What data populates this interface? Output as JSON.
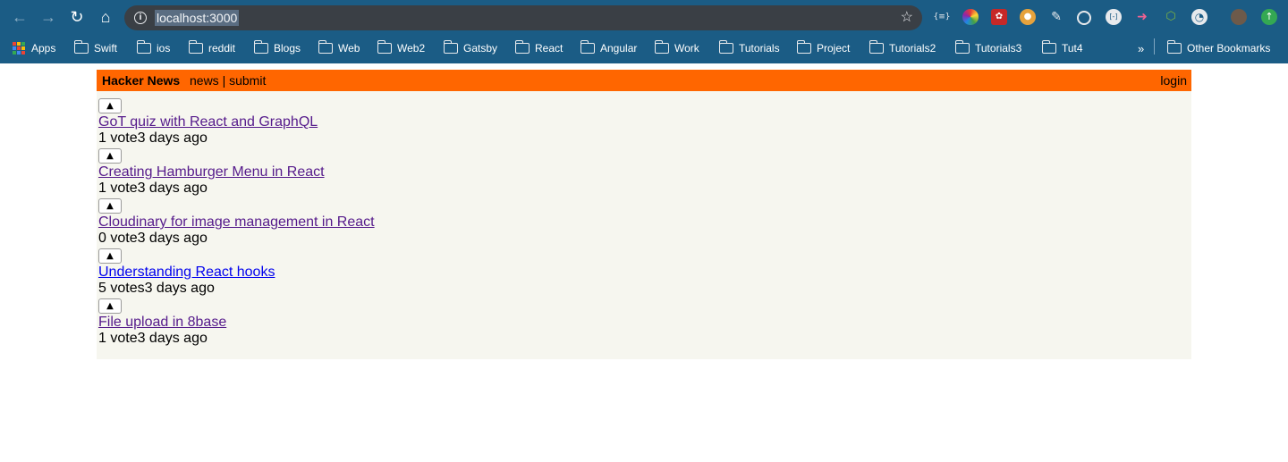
{
  "browser": {
    "address": "localhost:3000",
    "bookmarks": [
      "Apps",
      "Swift",
      "ios",
      "reddit",
      "Blogs",
      "Web",
      "Web2",
      "Gatsby",
      "React",
      "Angular",
      "Work",
      "Tutorials",
      "Project",
      "Tutorials2",
      "Tutorials3",
      "Tut4"
    ],
    "overflow": "»",
    "other_bookmarks": "Other Bookmarks"
  },
  "hn": {
    "brand": "Hacker News",
    "nav_news": "news",
    "nav_sep": "|",
    "nav_submit": "submit",
    "login": "login",
    "vote_glyph": "▲",
    "links": [
      {
        "title": "GoT quiz with React and GraphQL",
        "meta": "1 vote3 days ago"
      },
      {
        "title": "Creating Hamburger Menu in React",
        "meta": "1 vote3 days ago"
      },
      {
        "title": "Cloudinary for image management in React",
        "meta": "0 vote3 days ago"
      },
      {
        "title": "Understanding React hooks",
        "meta": "5 votes3 days ago"
      },
      {
        "title": "File upload in 8base",
        "meta": "1 vote3 days ago"
      }
    ]
  }
}
